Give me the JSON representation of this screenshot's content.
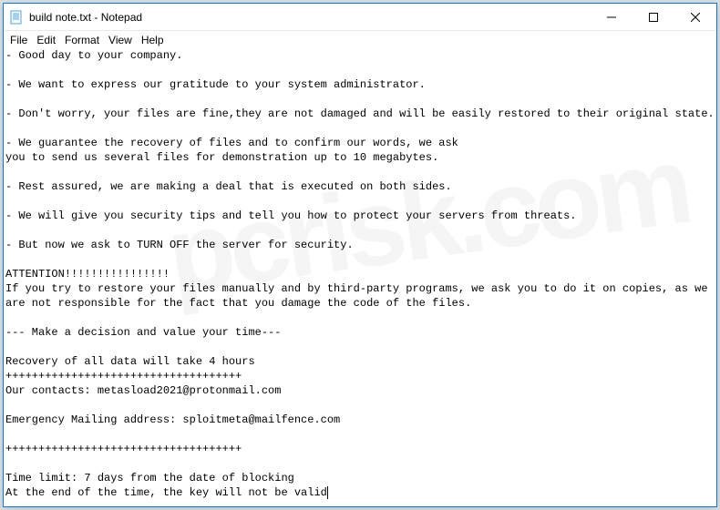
{
  "window": {
    "title": "build note.txt - Notepad",
    "icon": "notepad-icon"
  },
  "menubar": {
    "items": [
      "File",
      "Edit",
      "Format",
      "View",
      "Help"
    ]
  },
  "editor": {
    "text": "- Good day to your company.\n\n- We want to express our gratitude to your system administrator.\n\n- Don't worry, your files are fine,they are not damaged and will be easily restored to their original state.\n\n- We guarantee the recovery of files and to confirm our words, we ask\nyou to send us several files for demonstration up to 10 megabytes.\n\n- Rest assured, we are making a deal that is executed on both sides.\n\n- We will give you security tips and tell you how to protect your servers from threats.\n\n- But now we ask to TURN OFF the server for security.\n\nATTENTION!!!!!!!!!!!!!!!!\nIf you try to restore your files manually and by third-party programs, we ask you to do it on copies, as we are not responsible for the fact that you damage the code of the files.\n\n--- Make a decision and value your time---\n\nRecovery of all data will take 4 hours\n++++++++++++++++++++++++++++++++++++\nOur contacts: metasload2021@protonmail.com\n\nEmergency Mailing address: sploitmeta@mailfence.com\n\n++++++++++++++++++++++++++++++++++++\n\nTime limit: 7 days from the date of blocking\nAt the end of the time, the key will not be valid"
  },
  "watermark": "pcrisk.com"
}
